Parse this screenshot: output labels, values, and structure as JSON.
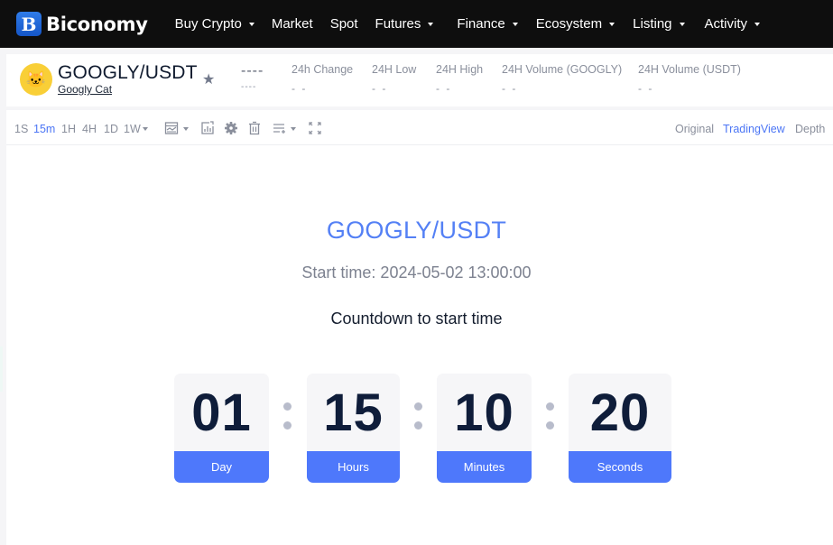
{
  "header": {
    "logo_letter": "B",
    "brand": "Biconomy",
    "nav": [
      {
        "label": "Buy Crypto",
        "dropdown": true
      },
      {
        "label": "Market",
        "dropdown": false
      },
      {
        "label": "Spot",
        "dropdown": false
      },
      {
        "label": "Futures",
        "dropdown": true
      },
      {
        "label": "Finance",
        "dropdown": true
      },
      {
        "label": "Ecosystem",
        "dropdown": true
      },
      {
        "label": "Listing",
        "dropdown": true
      },
      {
        "label": "Activity",
        "dropdown": true
      }
    ]
  },
  "ticker": {
    "pair": "GOOGLY/USDT",
    "coin_name": "Googly Cat",
    "coin_icon": "cat-avatar",
    "favorite_icon": "star-icon",
    "last_price": "----",
    "last_price_fiat": "----",
    "stats": [
      {
        "label": "24h Change",
        "value": "- -"
      },
      {
        "label": "24H Low",
        "value": "- -"
      },
      {
        "label": "24H High",
        "value": "- -"
      },
      {
        "label": "24H Volume (GOOGLY)",
        "value": "- -"
      },
      {
        "label": "24H Volume (USDT)",
        "value": "- -"
      }
    ]
  },
  "chart_toolbar": {
    "timeframes": [
      "1S",
      "15m",
      "1H",
      "4H",
      "1D",
      "1W"
    ],
    "active_timeframe": "15m",
    "tools": [
      "chart-type-icon",
      "indicators-icon",
      "settings-icon",
      "trash-icon",
      "drawing-list-icon",
      "fullscreen-icon"
    ],
    "views": [
      "Original",
      "TradingView",
      "Depth"
    ],
    "active_view": "TradingView"
  },
  "launch": {
    "title": "GOOGLY/USDT",
    "start_time": "Start time: 2024-05-02 13:00:00",
    "countdown_label": "Countdown to start time",
    "countdown": [
      {
        "value": "01",
        "unit": "Day"
      },
      {
        "value": "15",
        "unit": "Hours"
      },
      {
        "value": "10",
        "unit": "Minutes"
      },
      {
        "value": "20",
        "unit": "Seconds"
      }
    ]
  },
  "colors": {
    "accent": "#4e78fb",
    "title_blue": "#5480f5",
    "nav_bg": "#0e0e0e",
    "digit": "#0f1d3a"
  }
}
